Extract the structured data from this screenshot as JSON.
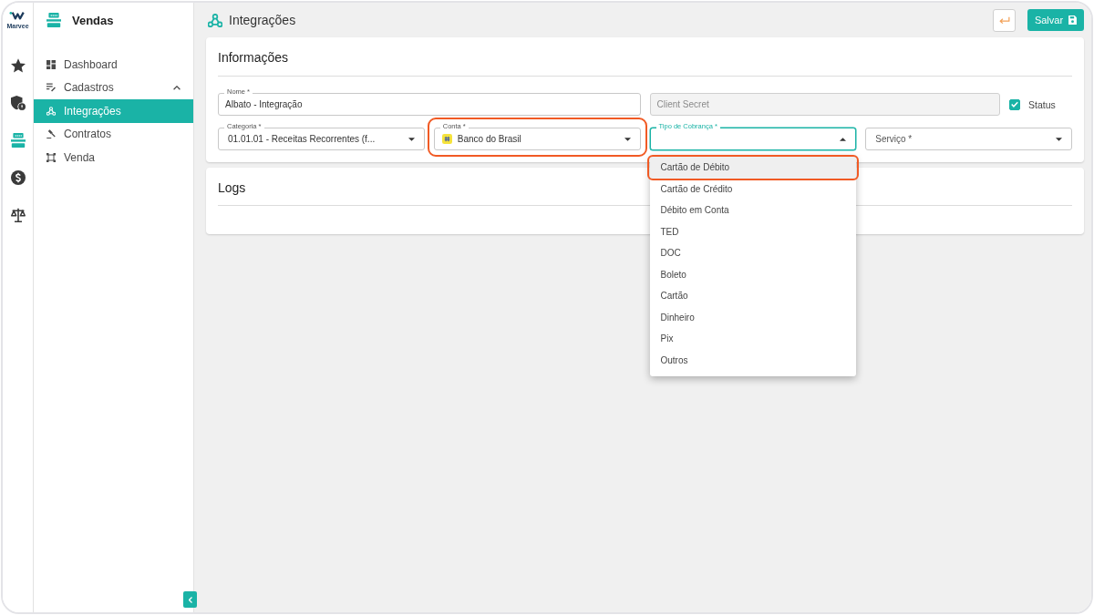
{
  "rail": {
    "logo": "Marvee",
    "items": [
      {
        "selected": false
      },
      {
        "selected": false
      },
      {
        "selected": true
      },
      {
        "selected": false
      },
      {
        "selected": false
      }
    ]
  },
  "sidebar": {
    "title": "Vendas",
    "items": [
      {
        "kind": "link",
        "label": "Dashboard",
        "selected": false
      },
      {
        "kind": "group",
        "label": "Cadastros",
        "selected": false,
        "expanded": true,
        "children": [
          {
            "label": "Integrações",
            "selected": true
          },
          {
            "label": "Contratos",
            "selected": false
          },
          {
            "label": "Venda",
            "selected": false
          }
        ]
      }
    ]
  },
  "header": {
    "title": "Integrações",
    "buttons": [
      {
        "kind": "back"
      },
      {
        "kind": "save",
        "label": "Salvar"
      }
    ]
  },
  "info_card": {
    "title": "Informações",
    "rows": [
      {
        "fields": [
          {
            "kind": "text",
            "label": "Nome *",
            "value": "Albato - Integração",
            "disabled": false,
            "focused": false,
            "highlighted": false
          },
          {
            "kind": "text",
            "placeholder": "Client Secret",
            "disabled": true,
            "focused": false,
            "highlighted": false
          }
        ],
        "checkbox": {
          "label": "Status",
          "checked": true
        }
      },
      {
        "fields": [
          {
            "kind": "select",
            "label": "Categoria *",
            "value": "01.01.01 - Receitas Recorrentes (f...",
            "disabled": false,
            "focused": false,
            "highlighted": false,
            "open": false
          },
          {
            "kind": "account",
            "label": "Conta *",
            "value": "Banco do Brasil",
            "disabled": false,
            "focused": false,
            "highlighted": true,
            "open": false
          },
          {
            "kind": "select",
            "label": "Tipo de Cobrança *",
            "disabled": false,
            "focused": true,
            "highlighted": false,
            "open": true,
            "options": [
              {
                "label": "Cartão de Débito",
                "selected": true,
                "highlighted": true
              },
              {
                "label": "Cartão de Crédito",
                "selected": false,
                "highlighted": false
              },
              {
                "label": "Débito em Conta",
                "selected": false,
                "highlighted": false
              },
              {
                "label": "TED",
                "selected": false,
                "highlighted": false
              },
              {
                "label": "DOC",
                "selected": false,
                "highlighted": false
              },
              {
                "label": "Boleto",
                "selected": false,
                "highlighted": false
              },
              {
                "label": "Cartão",
                "selected": false,
                "highlighted": false
              },
              {
                "label": "Dinheiro",
                "selected": false,
                "highlighted": false
              },
              {
                "label": "Pix",
                "selected": false,
                "highlighted": false
              },
              {
                "label": "Outros",
                "selected": false,
                "highlighted": false
              }
            ]
          },
          {
            "kind": "select",
            "placeholder": "Serviço *",
            "disabled": false,
            "focused": false,
            "highlighted": false,
            "open": false
          }
        ]
      }
    ]
  },
  "logs_card": {
    "title": "Logs"
  }
}
